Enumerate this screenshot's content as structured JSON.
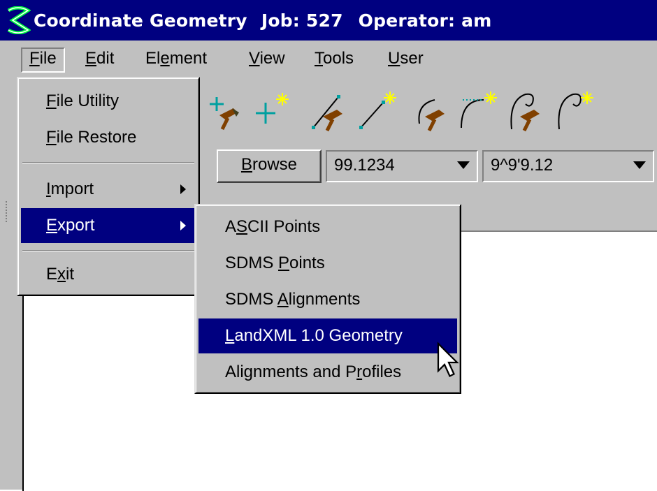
{
  "window": {
    "app_title": "Coordinate Geometry",
    "job": "Job: 527",
    "operator": "Operator: am"
  },
  "menubar": {
    "items": [
      {
        "label_u": "F",
        "label_rest": "ile"
      },
      {
        "label_u": "E",
        "label_rest": "dit"
      },
      {
        "label_pre": "El",
        "label_u": "e",
        "label_rest": "ment"
      },
      {
        "label_u": "V",
        "label_rest": "iew"
      },
      {
        "label_u": "T",
        "label_rest": "ools"
      },
      {
        "label_u": "U",
        "label_rest": "ser"
      }
    ]
  },
  "toolbar": {
    "browse_label_u": "B",
    "browse_label_rest": "rowse",
    "combo1_value": "99.1234",
    "combo2_value": "9^9'9.12",
    "icons": [
      "cogo-point-hammer-icon",
      "point-sparkle-icon",
      "line-hammer-icon",
      "line-sparkle-icon",
      "arc-hammer-icon",
      "curve-sparkle-icon",
      "spiral-hammer-icon",
      "spiral-sparkle-icon"
    ]
  },
  "file_menu": {
    "items": [
      {
        "u": "F",
        "rest": "ile Utility"
      },
      {
        "u": "F",
        "rest": "ile Restore"
      },
      {
        "u": "I",
        "rest": "mport"
      },
      {
        "u": "E",
        "rest": "xport"
      },
      {
        "pre": "E",
        "u": "x",
        "rest": "it"
      }
    ]
  },
  "export_submenu": {
    "items": [
      {
        "pre": "A",
        "u": "S",
        "rest": "CII Points"
      },
      {
        "pre": "SDMS ",
        "u": "P",
        "rest": "oints"
      },
      {
        "pre": "SDMS ",
        "u": "A",
        "rest": "lignments"
      },
      {
        "pre": "",
        "u": "L",
        "rest": "andXML 1.0 Geometry"
      },
      {
        "pre": "Alignments and P",
        "u": "r",
        "rest": "ofiles"
      }
    ],
    "highlighted_index": 3
  },
  "colors": {
    "title_bar": "#000080",
    "highlight": "#000080",
    "face": "#c0c0c0"
  }
}
